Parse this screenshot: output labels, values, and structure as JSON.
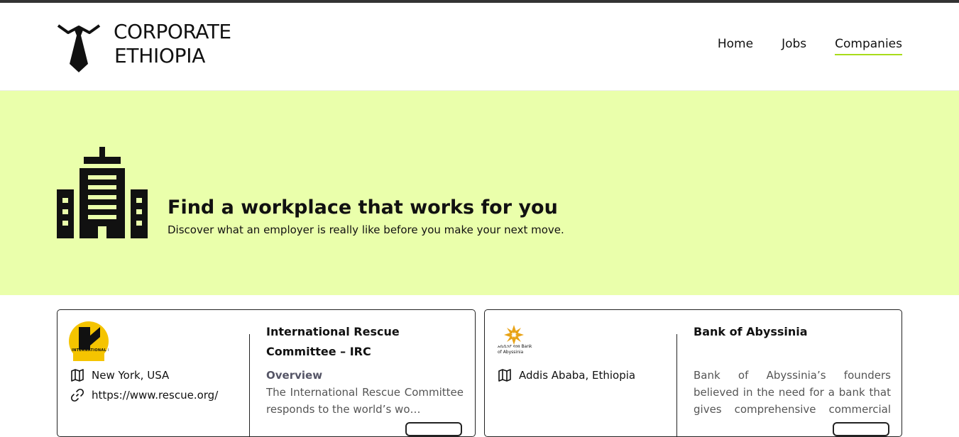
{
  "brand": {
    "line1": "CORPORATE",
    "line2": "ETHIOPIA"
  },
  "nav": {
    "home": "Home",
    "jobs": "Jobs",
    "companies": "Companies",
    "active": "Companies",
    "accent": "#a8dc1a"
  },
  "hero": {
    "title": "Find a workplace that works for you",
    "subtitle": "Discover what an employer is really like before you make your next move.",
    "background": "#eaffab",
    "icon": "office-building-icon"
  },
  "companies": [
    {
      "name": "International Rescue Committee – IRC",
      "logo": "irc-logo",
      "logo_text": "INTERNATIONAL RESCUE",
      "location": "New York, USA",
      "website": "https://www.rescue.org/",
      "overview_label": "Overview",
      "description": "The International Rescue Committee responds to the world’s wo…"
    },
    {
      "name": "Bank of Abyssinia",
      "logo": "bank-of-abyssinia-logo",
      "logo_text": "አቢሲንያ ባንክ Bank of Abyssinia",
      "location": "Addis Ababa, Ethiopia",
      "description": "Bank of Abyssinia’s founders believed in the need for a bank that gives comprehensive commercial banki…"
    }
  ]
}
